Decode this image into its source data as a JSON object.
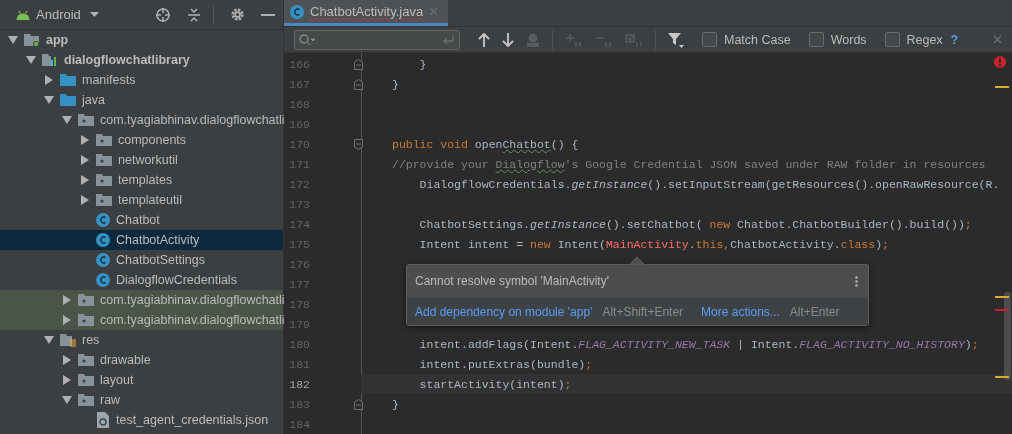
{
  "project_panel": {
    "view": "Android",
    "tree": [
      {
        "label": "app",
        "kind": "module",
        "expanded": true,
        "selected": false,
        "children": [
          {
            "label": "dialogflowchatlibrary",
            "kind": "library",
            "expanded": true,
            "selected": false,
            "children": [
              {
                "label": "manifests",
                "kind": "folder",
                "expanded": false,
                "selected": false
              },
              {
                "label": "java",
                "kind": "folder",
                "expanded": true,
                "selected": false,
                "children": [
                  {
                    "label": "com.tyagiabhinav.dialogflowchatli",
                    "kind": "package",
                    "expanded": true,
                    "selected": false,
                    "children": [
                      {
                        "label": "components",
                        "kind": "package",
                        "expanded": false,
                        "selected": false
                      },
                      {
                        "label": "networkutil",
                        "kind": "package",
                        "expanded": false,
                        "selected": false
                      },
                      {
                        "label": "templates",
                        "kind": "package",
                        "expanded": false,
                        "selected": false
                      },
                      {
                        "label": "templateutil",
                        "kind": "package",
                        "expanded": false,
                        "selected": false
                      },
                      {
                        "label": "Chatbot",
                        "kind": "class",
                        "selected": false
                      },
                      {
                        "label": "ChatbotActivity",
                        "kind": "class",
                        "selected": true
                      },
                      {
                        "label": "ChatbotSettings",
                        "kind": "class",
                        "selected": false
                      },
                      {
                        "label": "DialogflowCredentials",
                        "kind": "class",
                        "selected": false
                      }
                    ]
                  },
                  {
                    "label": "com.tyagiabhinav.dialogflowchatli",
                    "kind": "test_package",
                    "expanded": false,
                    "selected": false
                  },
                  {
                    "label": "com.tyagiabhinav.dialogflowchatli",
                    "kind": "test_package",
                    "expanded": false,
                    "selected": false
                  }
                ]
              },
              {
                "label": "res",
                "kind": "res",
                "expanded": true,
                "selected": false,
                "children": [
                  {
                    "label": "drawable",
                    "kind": "package",
                    "expanded": false,
                    "selected": false
                  },
                  {
                    "label": "layout",
                    "kind": "package",
                    "expanded": false,
                    "selected": false
                  },
                  {
                    "label": "raw",
                    "kind": "package",
                    "expanded": true,
                    "selected": false,
                    "children": [
                      {
                        "label": "test_agent_credentials.json",
                        "kind": "json",
                        "selected": false
                      }
                    ]
                  }
                ]
              }
            ]
          }
        ]
      }
    ]
  },
  "editor_tab": {
    "label": "ChatbotActivity.java",
    "selected": true
  },
  "find_bar": {
    "options": [
      {
        "label": "Match Case",
        "checked": false
      },
      {
        "label": "Words",
        "checked": false
      },
      {
        "label": "Regex",
        "checked": false
      }
    ],
    "help": "?"
  },
  "code": [
    {
      "number": "166",
      "current": false,
      "kind": "closer",
      "tokens": [
        {
          "kind": "text",
          "text": "    }"
        }
      ]
    },
    {
      "number": "167",
      "current": false,
      "kind": "closer",
      "tokens": [
        {
          "kind": "text",
          "text": "}"
        }
      ]
    },
    {
      "number": "168",
      "current": false
    },
    {
      "number": "169",
      "current": false
    },
    {
      "number": "170",
      "current": false,
      "kind": "opener",
      "tokens": [
        {
          "kind": "kw",
          "text": "public void "
        },
        {
          "kind": "text",
          "text": "open"
        },
        {
          "kind": "typo",
          "text": "Chatbot"
        },
        {
          "kind": "text",
          "text": "() {"
        }
      ]
    },
    {
      "number": "171",
      "current": false,
      "tokens": [
        {
          "kind": "comment",
          "text": "//provide your "
        },
        {
          "kind": "comment_typo",
          "text": "Dialogflow"
        },
        {
          "kind": "comment",
          "text": "'s Google Credential JSON saved under RAW folder in resources"
        }
      ]
    },
    {
      "number": "172",
      "current": false,
      "tokens": [
        {
          "kind": "text",
          "text": "    DialogflowCredentials."
        },
        {
          "kind": "italic",
          "text": "getInstance"
        },
        {
          "kind": "text",
          "text": "().setInputStream(getResources().openRawResource(R."
        }
      ]
    },
    {
      "number": "173",
      "current": false
    },
    {
      "number": "174",
      "current": false,
      "tokens": [
        {
          "kind": "text",
          "text": "    ChatbotSettings."
        },
        {
          "kind": "italic",
          "text": "getInstance"
        },
        {
          "kind": "text",
          "text": "().setChatbot( "
        },
        {
          "kind": "kw",
          "text": "new "
        },
        {
          "kind": "text",
          "text": "Chatbot.ChatbotBuilder().build())"
        },
        {
          "kind": "kw",
          "text": ";"
        }
      ]
    },
    {
      "number": "175",
      "current": false,
      "tokens": [
        {
          "kind": "text",
          "text": "    Intent intent = "
        },
        {
          "kind": "kw",
          "text": "new "
        },
        {
          "kind": "text",
          "text": "Intent("
        },
        {
          "kind": "error",
          "text": "MainActivity"
        },
        {
          "kind": "text",
          "text": "."
        },
        {
          "kind": "kw",
          "text": "this,"
        },
        {
          "kind": "text",
          "text": "ChatbotActivity."
        },
        {
          "kind": "kw",
          "text": "class"
        },
        {
          "kind": "text",
          "text": ")"
        },
        {
          "kind": "kw",
          "text": ";"
        }
      ]
    },
    {
      "number": "176",
      "current": false
    },
    {
      "number": "177",
      "current": false
    },
    {
      "number": "178",
      "current": false
    },
    {
      "number": "179",
      "current": false
    },
    {
      "number": "180",
      "current": false,
      "tokens": [
        {
          "kind": "text",
          "text": "    intent.addFlags(Intent."
        },
        {
          "kind": "static",
          "text": "FLAG_ACTIVITY_NEW_TASK"
        },
        {
          "kind": "text",
          "text": " | Intent."
        },
        {
          "kind": "static",
          "text": "FLAG_ACTIVITY_NO_HISTORY"
        },
        {
          "kind": "text",
          "text": ")"
        },
        {
          "kind": "kw",
          "text": ";"
        }
      ]
    },
    {
      "number": "181",
      "current": false,
      "tokens": [
        {
          "kind": "text",
          "text": "    intent.putExtras(bundle)"
        },
        {
          "kind": "kw",
          "text": ";"
        }
      ]
    },
    {
      "number": "182",
      "current": true,
      "tokens": [
        {
          "kind": "text",
          "text": "    startActivity(intent)"
        },
        {
          "kind": "kw",
          "text": ";"
        }
      ]
    },
    {
      "number": "183",
      "current": false,
      "kind": "closer",
      "tokens": [
        {
          "kind": "text",
          "text": "}"
        }
      ]
    },
    {
      "number": "184",
      "current": false
    }
  ],
  "error_popup": {
    "message": "Cannot resolve symbol 'MainActivity'",
    "actions": [
      {
        "label": "Add dependency on module 'app'",
        "shortcut": "Alt+Shift+Enter"
      },
      {
        "label": "More actions...",
        "shortcut": "Alt+Enter"
      }
    ]
  }
}
